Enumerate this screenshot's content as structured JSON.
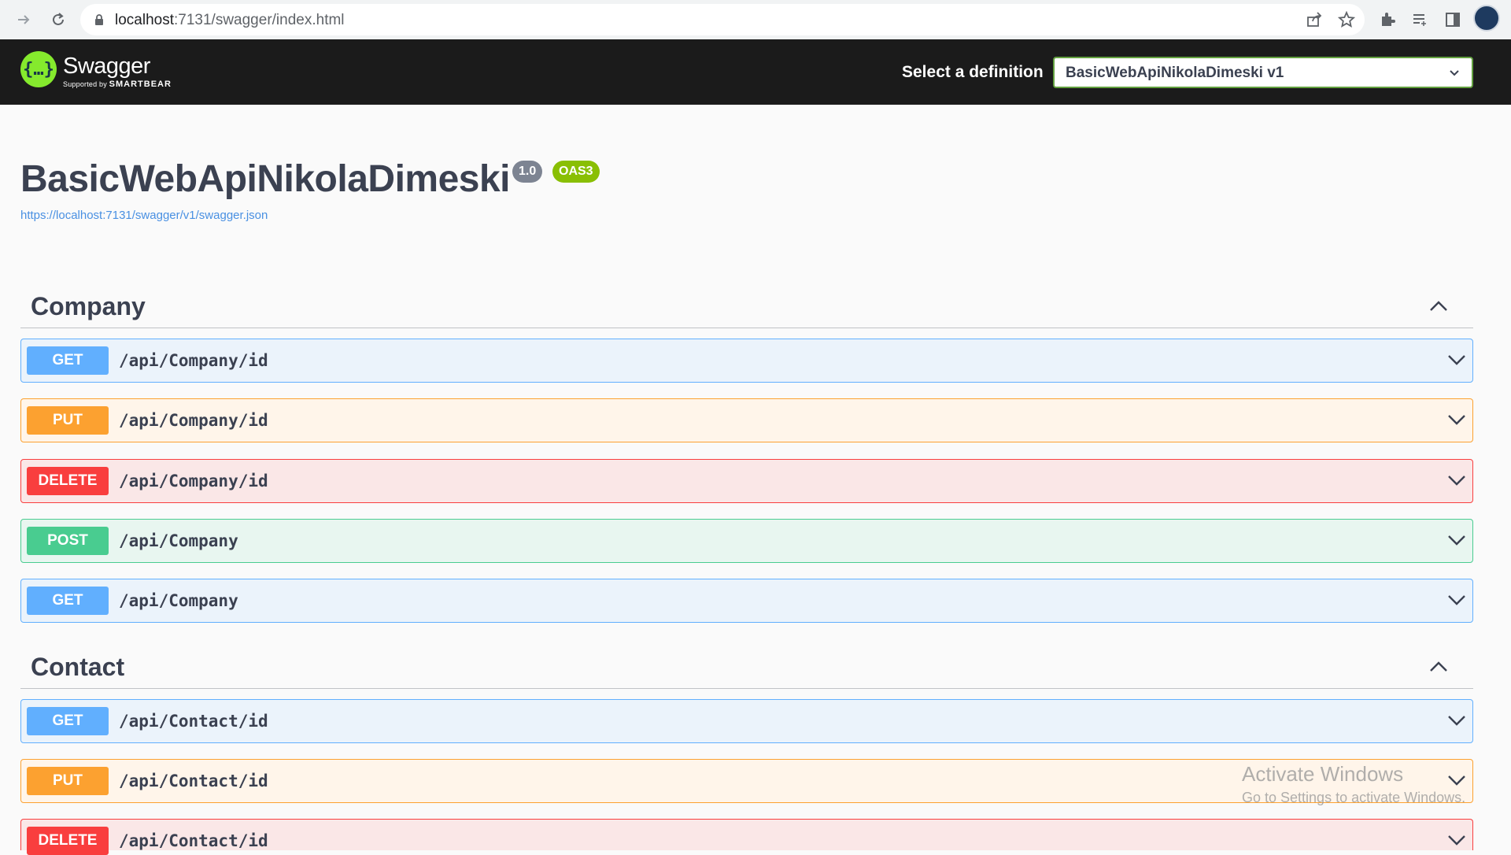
{
  "browser": {
    "url_host": "localhost",
    "url_rest": ":7131/swagger/index.html",
    "icons": [
      "forward-icon",
      "reload-icon",
      "lock-icon",
      "share-icon",
      "star-icon",
      "extensions-icon",
      "reading-list-icon",
      "side-panel-icon",
      "profile-avatar"
    ]
  },
  "topbar": {
    "logo_name": "Swagger",
    "logo_supported": "Supported by",
    "logo_brand": "SMARTBEAR",
    "select_label": "Select a definition",
    "selected_definition": "BasicWebApiNikolaDimeski v1"
  },
  "info": {
    "title": "BasicWebApiNikolaDimeski",
    "version": "1.0",
    "oas": "OAS3",
    "spec_url": "https://localhost:7131/swagger/v1/swagger.json"
  },
  "sections": [
    {
      "name": "Company",
      "operations": [
        {
          "method": "GET",
          "path": "/api/Company/id"
        },
        {
          "method": "PUT",
          "path": "/api/Company/id"
        },
        {
          "method": "DELETE",
          "path": "/api/Company/id"
        },
        {
          "method": "POST",
          "path": "/api/Company"
        },
        {
          "method": "GET",
          "path": "/api/Company"
        }
      ]
    },
    {
      "name": "Contact",
      "operations": [
        {
          "method": "GET",
          "path": "/api/Contact/id"
        },
        {
          "method": "PUT",
          "path": "/api/Contact/id"
        },
        {
          "method": "DELETE",
          "path": "/api/Contact/id"
        }
      ]
    }
  ],
  "watermark": {
    "line1": "Activate Windows",
    "line2": "Go to Settings to activate Windows."
  },
  "colors": {
    "get": "#61affe",
    "put": "#fca130",
    "delete": "#f93e3e",
    "post": "#49cc90",
    "topbar": "#1b1b1b",
    "logo": "#85ea2d"
  }
}
